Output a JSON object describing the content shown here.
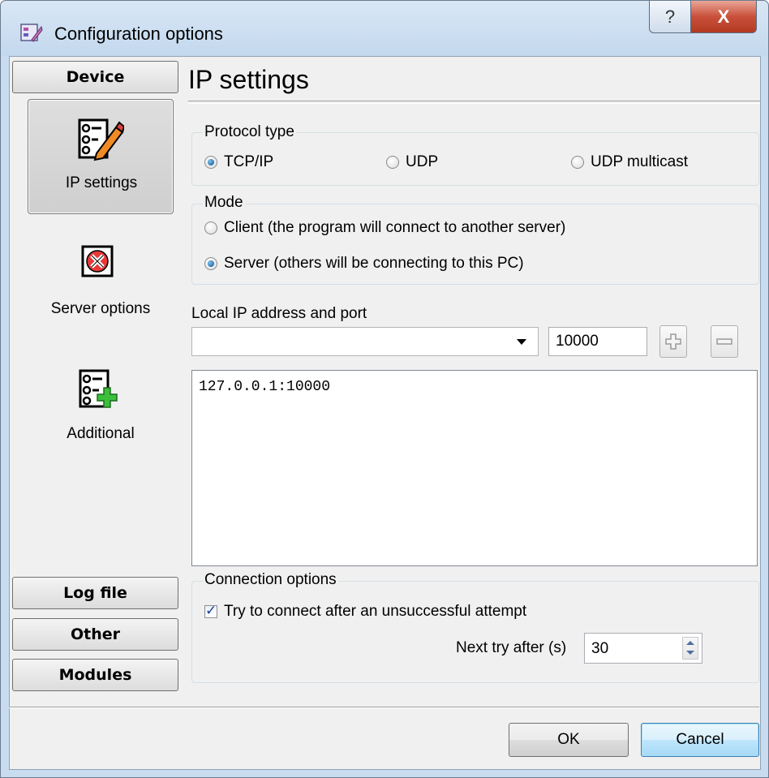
{
  "window": {
    "title": "Configuration options",
    "help_label": "?",
    "close_label": "X"
  },
  "sidebar": {
    "top_button": "Device",
    "items": [
      {
        "label": "IP settings",
        "icon": "checklist-pencil-icon",
        "active": true
      },
      {
        "label": "Server options",
        "icon": "red-x-icon",
        "active": false
      },
      {
        "label": "Additional",
        "icon": "checklist-plus-icon",
        "active": false
      }
    ],
    "bottom_buttons": [
      "Log file",
      "Other",
      "Modules"
    ]
  },
  "main": {
    "section_title": "IP settings",
    "protocol": {
      "label": "Protocol type",
      "options": [
        "TCP/IP",
        "UDP",
        "UDP multicast"
      ],
      "selected": "TCP/IP"
    },
    "mode": {
      "label": "Mode",
      "options": [
        "Client (the program will connect to another server)",
        "Server (others will be connecting to this PC)"
      ],
      "selected": "Server (others will be connecting to this PC)"
    },
    "local_ip": {
      "label": "Local IP address and port",
      "address_value": "",
      "port_value": "10000",
      "add_icon": "plus-icon",
      "remove_icon": "minus-icon",
      "list": [
        "127.0.0.1:10000"
      ]
    },
    "connection": {
      "label": "Connection options",
      "retry_label": "Try to connect after an unsuccessful attempt",
      "retry_checked": true,
      "next_try_label": "Next try after (s)",
      "next_try_value": "30"
    }
  },
  "footer": {
    "ok_label": "OK",
    "cancel_label": "Cancel"
  },
  "colors": {
    "frame": "#c9dcef",
    "client": "#f0f0f0",
    "close_red": "#c9503a"
  }
}
